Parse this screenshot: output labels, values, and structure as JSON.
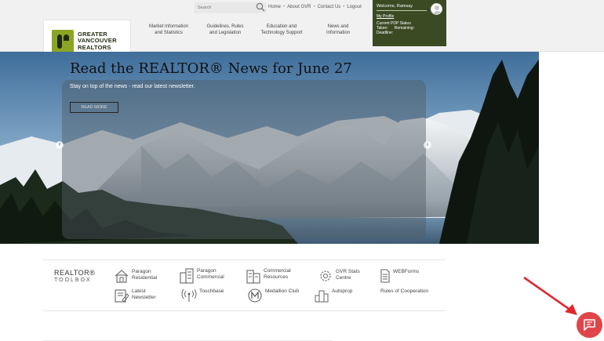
{
  "header": {
    "logo": {
      "line1": "GREATER",
      "line2": "VANCOUVER",
      "line3": "REALTORS"
    },
    "search_placeholder": "Search",
    "utility_links": [
      "Home",
      "About GVR",
      "Contact Us",
      "Logout"
    ],
    "nav": [
      {
        "line1": "Market Information",
        "line2": "and Statistics"
      },
      {
        "line1": "Guidelines, Rules",
        "line2": "and Legislation"
      },
      {
        "line1": "Education and",
        "line2": "Technology Support"
      },
      {
        "line1": "News and",
        "line2": "Information"
      }
    ],
    "welcome": {
      "greeting": "Welcome, Ramsay",
      "profile_link": "My Profile",
      "status_label": "Current PDP Status",
      "taken_label": "Taken:",
      "remaining_label": "Remaining:",
      "deadline_label": "Deadline:"
    }
  },
  "hero": {
    "title": "Read the REALTOR® News for June 27",
    "subtitle": "Stay on top of the news - read our latest newsletter.",
    "button_label": "READ MORE",
    "prev_glyph": "‹",
    "next_glyph": "›"
  },
  "toolbox": {
    "title": "REALTOR®",
    "subtitle": "TOOLBOX",
    "tools": [
      {
        "line1": "Paragon",
        "line2": "Residential",
        "icon": "house-icon"
      },
      {
        "line1": "Paragon",
        "line2": "Commercial",
        "icon": "building-icon"
      },
      {
        "line1": "Commercial",
        "line2": "Resources",
        "icon": "commercial-building-icon"
      },
      {
        "line1": "GVR Stats",
        "line2": "Centre",
        "icon": "gear-icon"
      },
      {
        "line1": "WEBForms",
        "line2": "",
        "icon": "document-icon"
      },
      {
        "line1": "Latest",
        "line2": "Newsletter",
        "icon": "newsletter-icon"
      },
      {
        "line1": "Touchbase",
        "line2": "",
        "icon": "broadcast-icon"
      },
      {
        "line1": "Medallion Club",
        "line2": "",
        "icon": "medallion-icon"
      },
      {
        "line1": "Autoprop",
        "line2": "",
        "icon": "city-icon"
      },
      {
        "line1": "Rules of Cooperation",
        "line2": "",
        "icon": "none"
      }
    ]
  },
  "chat": {
    "icon": "chat-icon",
    "color": "#e0454a"
  },
  "colors": {
    "brand_green": "#8aa523",
    "welcome_bg": "#3c4a24",
    "annotation_red": "#e0282e"
  }
}
